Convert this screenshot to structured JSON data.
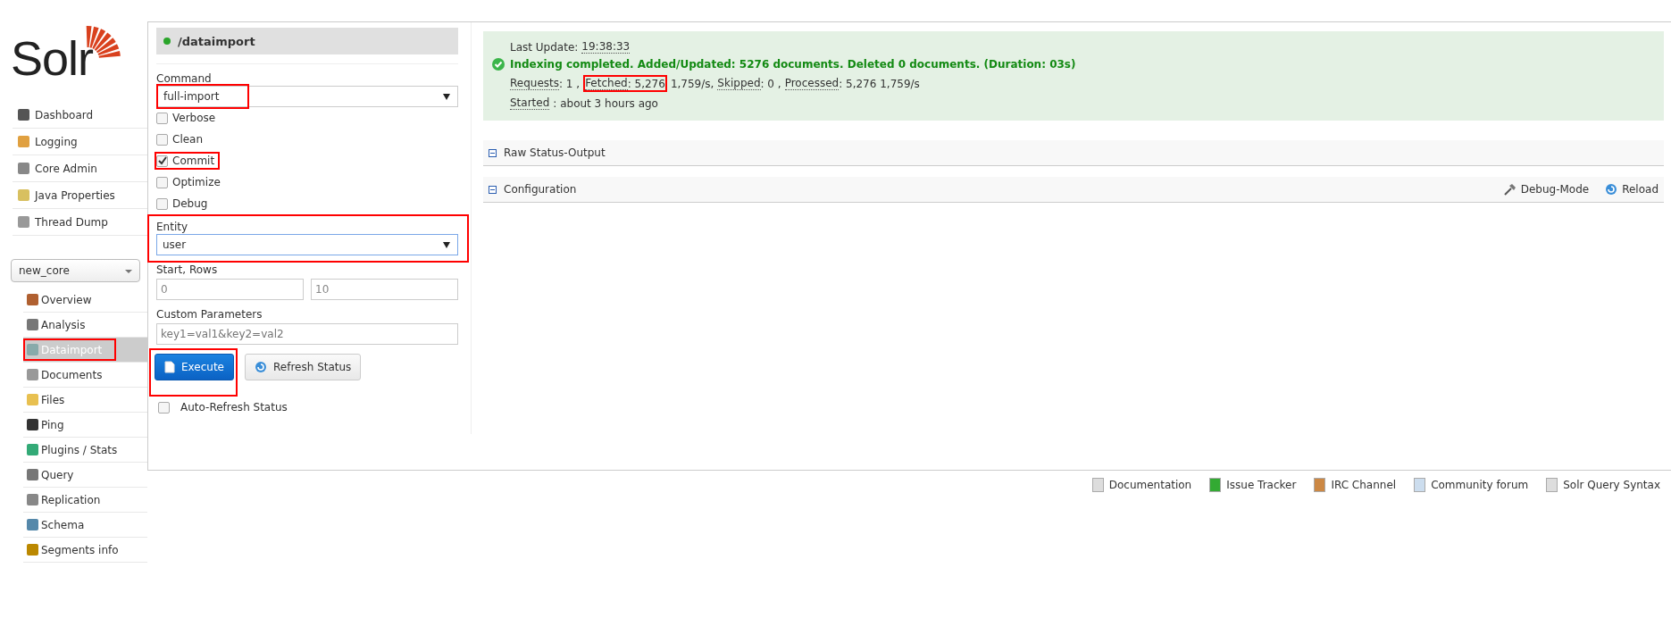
{
  "logo": {
    "text": "Solr"
  },
  "nav": [
    {
      "label": "Dashboard"
    },
    {
      "label": "Logging"
    },
    {
      "label": "Core Admin"
    },
    {
      "label": "Java Properties"
    },
    {
      "label": "Thread Dump"
    }
  ],
  "core_selector": {
    "value": "new_core"
  },
  "core_nav": [
    {
      "label": "Overview",
      "selected": false,
      "highlighted": false
    },
    {
      "label": "Analysis",
      "selected": false,
      "highlighted": false
    },
    {
      "label": "Dataimport",
      "selected": true,
      "highlighted": true
    },
    {
      "label": "Documents",
      "selected": false,
      "highlighted": false
    },
    {
      "label": "Files",
      "selected": false,
      "highlighted": false
    },
    {
      "label": "Ping",
      "selected": false,
      "highlighted": false
    },
    {
      "label": "Plugins / Stats",
      "selected": false,
      "highlighted": false
    },
    {
      "label": "Query",
      "selected": false,
      "highlighted": false
    },
    {
      "label": "Replication",
      "selected": false,
      "highlighted": false
    },
    {
      "label": "Schema",
      "selected": false,
      "highlighted": false
    },
    {
      "label": "Segments info",
      "selected": false,
      "highlighted": false
    }
  ],
  "handler": {
    "title": "/dataimport"
  },
  "command": {
    "label": "Command",
    "value": "full-import",
    "highlighted": true
  },
  "options": [
    {
      "label": "Verbose",
      "checked": false,
      "highlighted": false
    },
    {
      "label": "Clean",
      "checked": false,
      "highlighted": false
    },
    {
      "label": "Commit",
      "checked": true,
      "highlighted": true
    },
    {
      "label": "Optimize",
      "checked": false,
      "highlighted": false
    },
    {
      "label": "Debug",
      "checked": false,
      "highlighted": false
    }
  ],
  "entity": {
    "label": "Entity",
    "value": "user",
    "highlighted": true
  },
  "start_rows": {
    "label": "Start, Rows",
    "start": "0",
    "rows": "10"
  },
  "custom_parameters": {
    "label": "Custom Parameters",
    "placeholder": "key1=val1&key2=val2"
  },
  "buttons": [
    {
      "label": "Execute",
      "kind": "primary",
      "highlighted": true
    },
    {
      "label": "Refresh Status",
      "kind": "default",
      "highlighted": false
    }
  ],
  "auto_refresh": {
    "label": "Auto-Refresh Status",
    "checked": false
  },
  "status": {
    "last_update_label": "Last Update:",
    "last_update_time": "19:38:33",
    "message": "Indexing completed. Added/Updated: 5276 documents. Deleted 0 documents. (Duration: 03s)",
    "stats": [
      {
        "label": "Requests",
        "value": ": 1 ,",
        "highlighted": false
      },
      {
        "label": "Fetched",
        "value": ": 5,276",
        "highlighted": true
      },
      {
        "value": "1,759/s,",
        "highlighted": false
      },
      {
        "label": "Skipped",
        "value": ": 0 ,",
        "highlighted": false
      },
      {
        "label": "Processed",
        "value": ": 5,276 1,759/s",
        "highlighted": false
      }
    ],
    "started_label": "Started",
    "started_value": ": about 3 hours ago"
  },
  "sections": [
    {
      "title": "Raw Status-Output",
      "expanded": true
    },
    {
      "title": "Configuration",
      "expanded": true,
      "actions": [
        {
          "label": "Debug-Mode",
          "kind": "debug"
        },
        {
          "label": "Reload",
          "kind": "reload"
        }
      ]
    }
  ],
  "footer_links": [
    {
      "label": "Documentation"
    },
    {
      "label": "Issue Tracker"
    },
    {
      "label": "IRC Channel"
    },
    {
      "label": "Community forum"
    },
    {
      "label": "Solr Query Syntax"
    }
  ]
}
